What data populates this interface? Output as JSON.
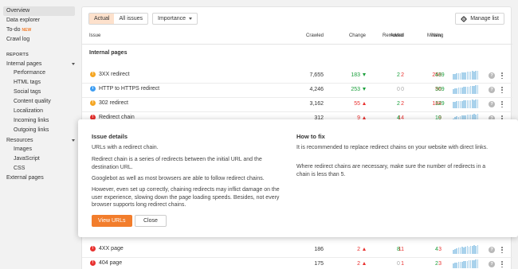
{
  "sidebar": {
    "top_items": [
      {
        "label": "Overview"
      },
      {
        "label": "Data explorer"
      },
      {
        "label": "To-do",
        "badge": "NEW"
      },
      {
        "label": "Crawl log"
      }
    ],
    "reports_header": "REPORTS",
    "internal_pages": "Internal pages",
    "internal_sub": [
      "Performance",
      "HTML tags",
      "Social tags",
      "Content quality",
      "Localization",
      "Incoming links",
      "Outgoing links"
    ],
    "resources": "Resources",
    "resources_sub": [
      "Images",
      "JavaScript",
      "CSS"
    ],
    "external_pages": "External pages"
  },
  "toolbar": {
    "tab_actual": "Actual",
    "tab_all": "All issues",
    "importance": "Importance",
    "manage_list": "Manage list"
  },
  "table": {
    "headers": {
      "issue": "Issue",
      "crawled": "Crawled",
      "change": "Change",
      "added": "Added",
      "new": "New",
      "removed": "Removed",
      "missing": "Missing"
    },
    "section": "Internal pages",
    "rows": [
      {
        "icon": "warning-icon",
        "label": "3XX redirect",
        "crawled": "7,655",
        "change": "183",
        "change_dir": "down",
        "added": "2",
        "new": "256",
        "removed": "2",
        "missing": "439",
        "spark": [
          60,
          65,
          70,
          75,
          70,
          80,
          85,
          80,
          90,
          95,
          90,
          100,
          95,
          100,
          100
        ]
      },
      {
        "icon": "info-icon",
        "label": "HTTP to HTTPS redirect",
        "crawled": "4,246",
        "change": "253",
        "change_dir": "down",
        "added": "0",
        "new": "56",
        "removed": "0",
        "missing": "309",
        "spark": [
          55,
          60,
          65,
          70,
          70,
          75,
          80,
          80,
          85,
          85,
          90,
          95,
          95,
          100,
          100
        ]
      },
      {
        "icon": "warning-icon",
        "label": "302 redirect",
        "crawled": "3,162",
        "change": "55",
        "change_dir": "up",
        "added": "2",
        "new": "184",
        "removed": "2",
        "missing": "129",
        "spark": [
          70,
          75,
          80,
          85,
          80,
          85,
          90,
          90,
          95,
          95,
          90,
          100,
          95,
          100,
          100
        ]
      },
      {
        "icon": "error-icon",
        "label": "Redirect chain",
        "crawled": "312",
        "change": "9",
        "change_dir": "up",
        "added": "14",
        "new": "9",
        "removed": "4",
        "missing": "10",
        "spark": [
          50,
          60,
          70,
          65,
          75,
          80,
          85,
          80,
          90,
          95,
          90,
          95,
          100,
          95,
          100
        ]
      },
      {
        "icon": "error-icon",
        "label": "4XX page",
        "crawled": "186",
        "change": "2",
        "change_dir": "up",
        "added": "11",
        "new": "3",
        "removed": "8",
        "missing": "4",
        "spark": [
          50,
          55,
          60,
          70,
          75,
          80,
          75,
          85,
          90,
          85,
          95,
          90,
          100,
          95,
          100
        ]
      },
      {
        "icon": "error-icon",
        "label": "404 page",
        "crawled": "175",
        "change": "2",
        "change_dir": "up",
        "added": "1",
        "new": "3",
        "removed": "0",
        "missing": "2",
        "spark": [
          55,
          60,
          65,
          70,
          75,
          75,
          80,
          85,
          85,
          90,
          90,
          95,
          95,
          100,
          100
        ]
      }
    ]
  },
  "details": {
    "issue_title": "Issue details",
    "issue_p1": "URLs with a redirect chain.",
    "issue_p2": "Redirect chain is a series of redirects between the initial URL and the destination URL.",
    "issue_p3": "Googlebot as well as most browsers are able to follow redirect chains.",
    "issue_p4": "However, even set up correctly, chaining redirects may inflict damage on the user experience, slowing down the page loading speeds. Besides, not every browser supports long redirect chains.",
    "fix_title": "How to fix",
    "fix_p1": "It is recommended to replace redirect chains on your website with direct links.",
    "fix_p2": "Where redirect chains are necessary, make sure the number of redirects in a chain is less than 5.",
    "view_urls": "View URLs",
    "close": "Close"
  },
  "colors": {
    "accent": "#f27d2c",
    "error": "#e8312f",
    "success": "#1a9f3b",
    "warning": "#f5a623",
    "info": "#3d9df2",
    "spark": "#a9d2ec"
  }
}
